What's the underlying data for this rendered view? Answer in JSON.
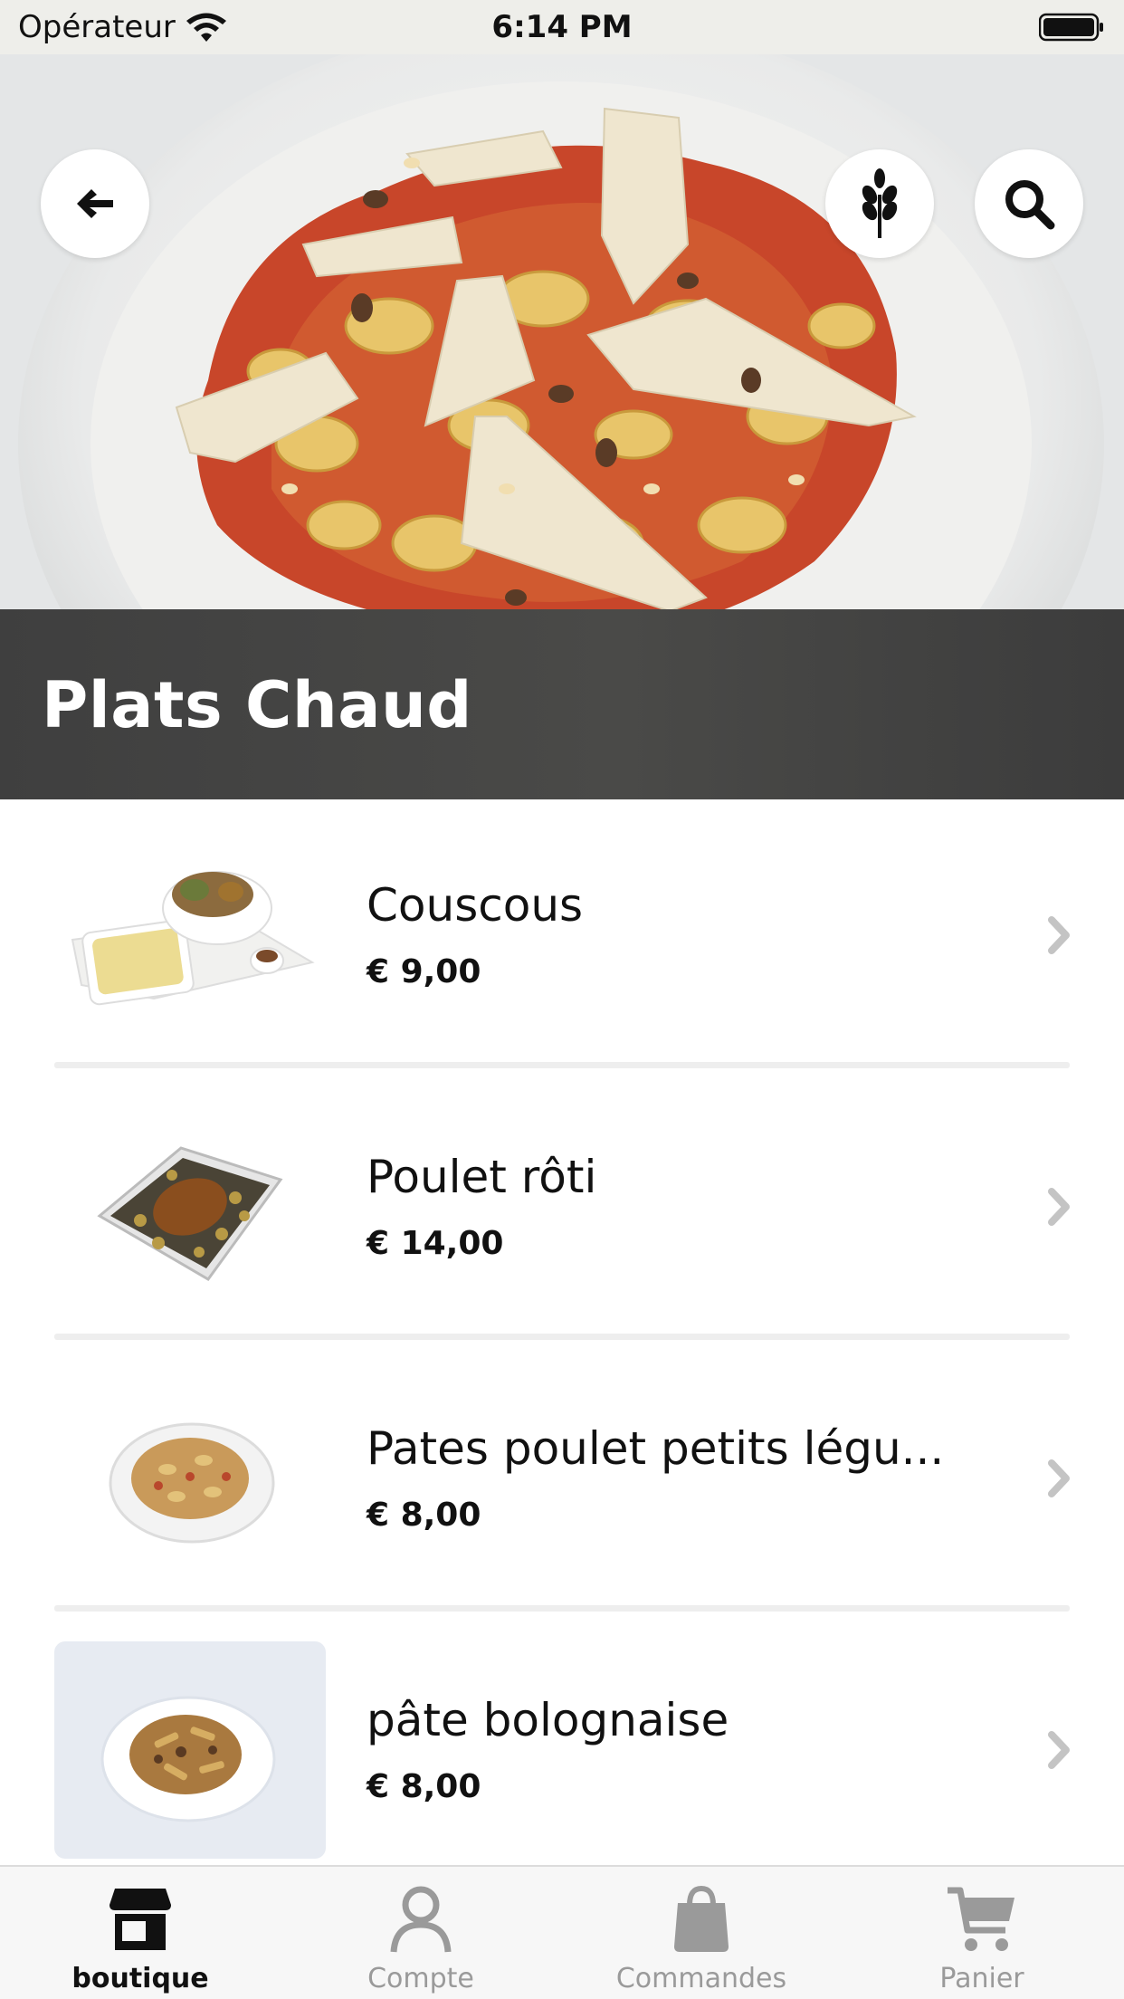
{
  "status_bar": {
    "carrier": "Opérateur",
    "time": "6:14 PM"
  },
  "header": {
    "title": "Plats Chaud",
    "back_icon": "arrow-left-icon",
    "allergen_icon": "wheat-icon",
    "search_icon": "search-icon"
  },
  "products": [
    {
      "name": "Couscous",
      "price": "€ 9,00"
    },
    {
      "name": "Poulet rôti",
      "price": "€ 14,00"
    },
    {
      "name": "Pates poulet  petits légu...",
      "price": "€ 8,00"
    },
    {
      "name": "pâte bolognaise",
      "price": "€ 8,00"
    }
  ],
  "tab_bar": {
    "active": "boutique",
    "tabs": [
      {
        "label": "boutique",
        "icon": "store-icon"
      },
      {
        "label": "Compte",
        "icon": "user-icon"
      },
      {
        "label": "Commandes",
        "icon": "bag-icon"
      },
      {
        "label": "Panier",
        "icon": "cart-icon"
      }
    ]
  },
  "colors": {
    "tab_active": "#111111",
    "tab_inactive": "#9a9a9a",
    "banner": "#434342"
  }
}
